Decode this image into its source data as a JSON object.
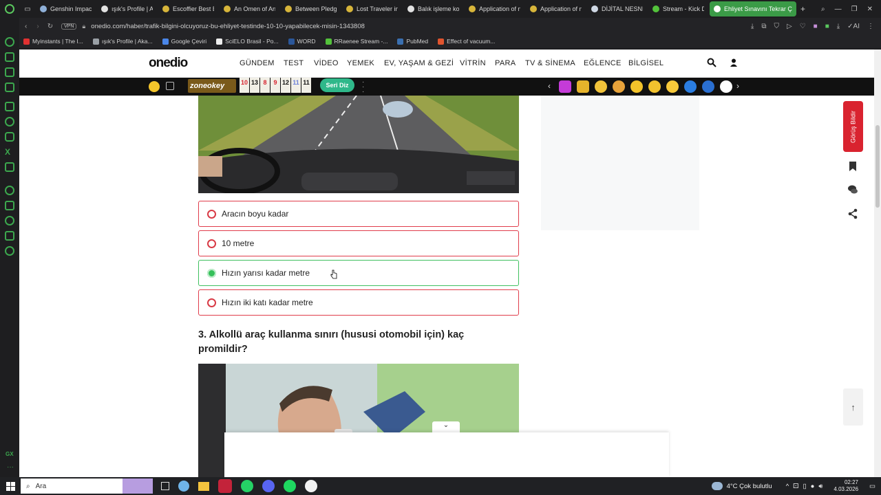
{
  "browser": {
    "tabs": [
      {
        "title": "Genshin Impact",
        "color": "#8fb0d8"
      },
      {
        "title": "ışık's Profile | A",
        "color": "#e2e2e2"
      },
      {
        "title": "Escoffier Best B",
        "color": "#d7b53a"
      },
      {
        "title": "An Omen of An",
        "color": "#d7b53a"
      },
      {
        "title": "Between Pledg",
        "color": "#d7b53a"
      },
      {
        "title": "Lost Traveler in",
        "color": "#d7b53a"
      },
      {
        "title": "Balık işleme kon",
        "color": "#e2e2e2"
      },
      {
        "title": "Application of n",
        "color": "#d7b53a"
      },
      {
        "title": "Application of n",
        "color": "#d7b53a"
      },
      {
        "title": "DİJİTAL NESNE",
        "color": "#cfd8e4"
      },
      {
        "title": "Stream - Kick D",
        "color": "#53c23b"
      },
      {
        "title": "Ehliyet Sınavını Tekrar Çö",
        "color": "#ffffff",
        "active": true
      }
    ],
    "url": "onedio.com/haber/trafik-bilgini-olcuyoruz-bu-ehliyet-testinde-10-10-yapabilecek-misin-1343808",
    "vpn_label": "VPN",
    "bookmarks": [
      {
        "label": "Myinstants | The I...",
        "color": "#e03131"
      },
      {
        "label": "ışık's Profile | Aka...",
        "color": "#9aa0a6"
      },
      {
        "label": "Google Çeviri",
        "color": "#4a86e8"
      },
      {
        "label": "SciELO Brasil - Po...",
        "color": "#eeeeee"
      },
      {
        "label": "WORD",
        "color": "#2b579a"
      },
      {
        "label": "RRaenee Stream -...",
        "color": "#53c23b"
      },
      {
        "label": "PubMed",
        "color": "#3a6fb0"
      },
      {
        "label": "Effect of vacuum...",
        "color": "#e0542e"
      }
    ]
  },
  "site": {
    "logo": "onedio",
    "nav": [
      "GÜNDEM",
      "TEST",
      "VİDEO",
      "YEMEK",
      "EV, YAŞAM & GEZİ",
      "VİTRİN",
      "PARA",
      "TV & SİNEMA",
      "EĞLENCE",
      "BİLGİSEL"
    ],
    "zone_label": "zoneokey",
    "zone_tiles": [
      "10",
      "13",
      "8",
      "9",
      "12",
      "11",
      "11"
    ],
    "seri_diz": "Seri Diz",
    "feedback_label": "Görüş Bildir"
  },
  "question2": {
    "options": [
      {
        "label": "Aracın boyu kadar",
        "state": "wrong"
      },
      {
        "label": "10 metre",
        "state": "wrong"
      },
      {
        "label": "Hızın yarısı kadar metre",
        "state": "correct"
      },
      {
        "label": "Hızın iki katı kadar metre",
        "state": "wrong"
      }
    ]
  },
  "question3": {
    "title": "3. Alkollü araç kullanma sınırı (hususi otomobil için) kaç promildir?"
  },
  "taskbar": {
    "search_placeholder": "Ara",
    "weather": "4°C  Çok bulutlu",
    "time": "02:27",
    "date": "4.03.2026"
  },
  "colors": {
    "accent_red": "#e03c4a",
    "accent_green": "#3fbf5e",
    "browser_green": "#3b9b47"
  }
}
